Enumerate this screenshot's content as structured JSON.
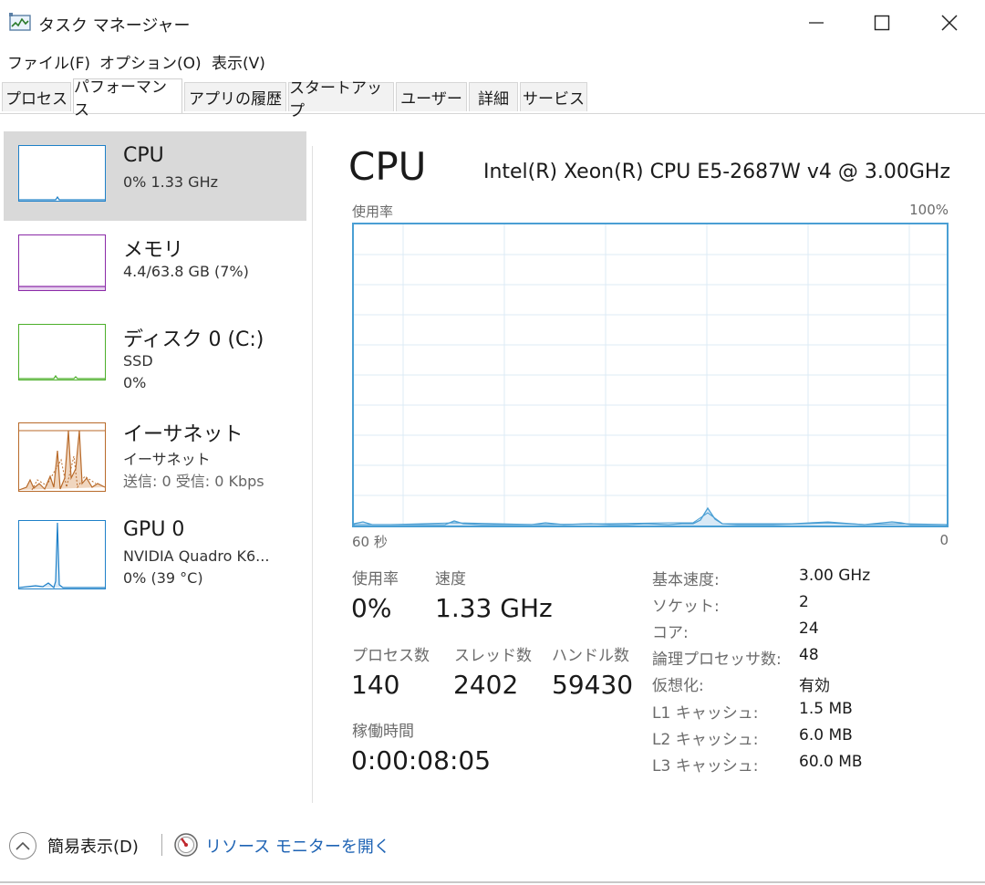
{
  "window": {
    "title": "タスク マネージャー",
    "minimize_icon": "minimize-icon",
    "maximize_icon": "maximize-icon",
    "close_icon": "close-icon"
  },
  "menu": [
    "ファイル(F)",
    "オプション(O)",
    "表示(V)"
  ],
  "tabs": [
    {
      "label": "プロセス",
      "active": false
    },
    {
      "label": "パフォーマンス",
      "active": true
    },
    {
      "label": "アプリの履歴",
      "active": false
    },
    {
      "label": "スタートアップ",
      "active": false
    },
    {
      "label": "ユーザー",
      "active": false
    },
    {
      "label": "詳細",
      "active": false
    },
    {
      "label": "サービス",
      "active": false
    }
  ],
  "sidebar": [
    {
      "title": "CPU",
      "lines": [
        "0%  1.33 GHz"
      ],
      "color": "#1e80c8",
      "selected": true
    },
    {
      "title": "メモリ",
      "lines": [
        "4.4/63.8 GB (7%)"
      ],
      "color": "#8b2aa8",
      "selected": false
    },
    {
      "title": "ディスク 0 (C:)",
      "lines": [
        "SSD",
        "0%"
      ],
      "color": "#4caf2a",
      "selected": false
    },
    {
      "title": "イーサネット",
      "lines": [
        "イーサネット",
        "送信: 0 受信: 0 Kbps"
      ],
      "color": "#b86a2a",
      "selected": false
    },
    {
      "title": "GPU 0",
      "lines": [
        "NVIDIA Quadro K6...",
        "0%  (39 °C)"
      ],
      "color": "#1e80c8",
      "selected": false
    }
  ],
  "main": {
    "title": "CPU",
    "model": "Intel(R) Xeon(R) CPU E5-2687W v4 @ 3.00GHz",
    "graph_label_left": "使用率",
    "graph_label_right": "100%",
    "graph_bottom_left": "60 秒",
    "graph_bottom_right": "0",
    "graph_color": "#4a9fd4",
    "stats": {
      "usage_label": "使用率",
      "usage_value": "0%",
      "speed_label": "速度",
      "speed_value": "1.33 GHz",
      "processes_label": "プロセス数",
      "processes_value": "140",
      "threads_label": "スレッド数",
      "threads_value": "2402",
      "handles_label": "ハンドル数",
      "handles_value": "59430",
      "uptime_label": "稼働時間",
      "uptime_value": "0:00:08:05"
    },
    "specs": [
      {
        "key": "基本速度:",
        "value": "3.00 GHz"
      },
      {
        "key": "ソケット:",
        "value": "2"
      },
      {
        "key": "コア:",
        "value": "24"
      },
      {
        "key": "論理プロセッサ数:",
        "value": "48"
      },
      {
        "key": "仮想化:",
        "value": "有効"
      },
      {
        "key": "L1 キャッシュ:",
        "value": "1.5 MB"
      },
      {
        "key": "L2 キャッシュ:",
        "value": "6.0 MB"
      },
      {
        "key": "L3 キャッシュ:",
        "value": "60.0 MB"
      }
    ]
  },
  "footer": {
    "collapse_label": "簡易表示(D)",
    "monitor_label": "リソース モニターを開く",
    "collapse_icon": "chevron-up-icon",
    "monitor_icon": "resource-monitor-icon"
  }
}
